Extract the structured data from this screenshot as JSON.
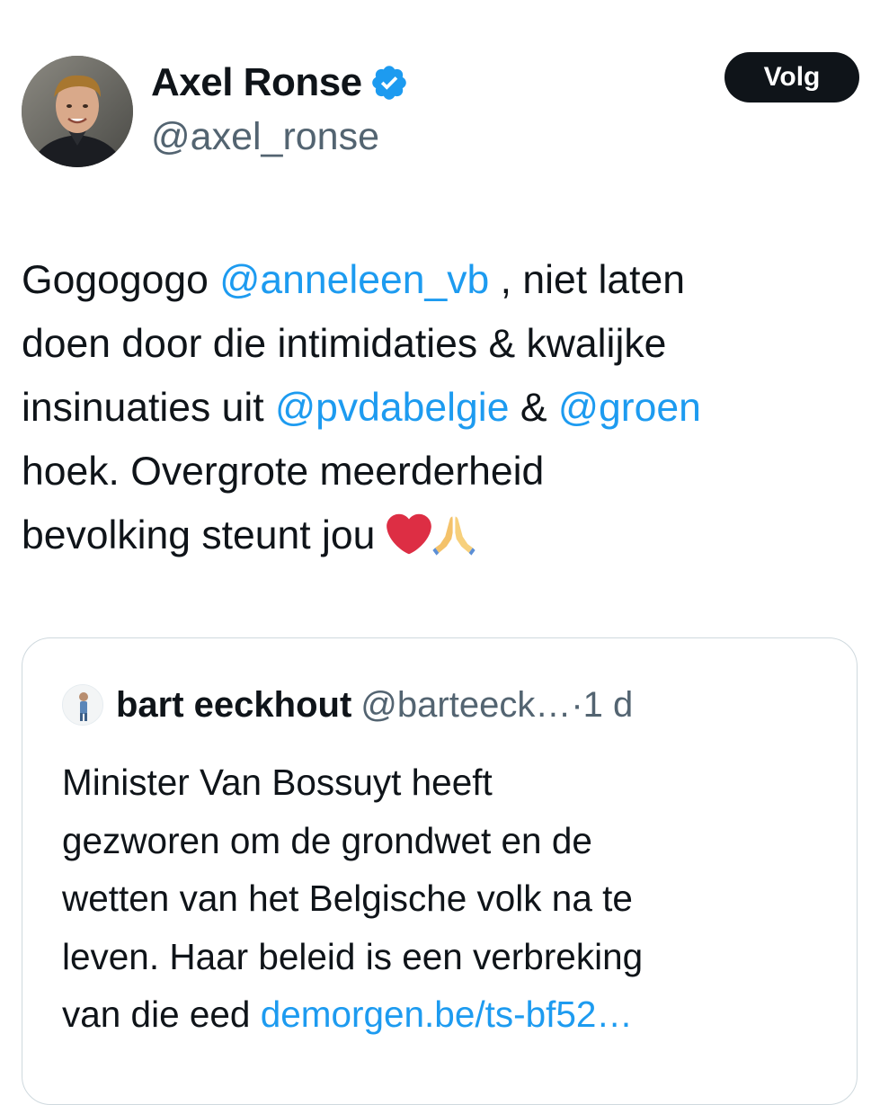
{
  "author": {
    "display_name": "Axel Ronse",
    "handle": "@axel_ronse",
    "verified_icon": "verified-badge-icon"
  },
  "follow_button": {
    "label": "Volg"
  },
  "tweet": {
    "lines": [
      [
        {
          "text": "Gogogogo "
        },
        {
          "text": "@anneleen_vb",
          "mention": true
        },
        {
          "text": " , niet laten"
        }
      ],
      [
        {
          "text": "doen door die intimidaties & kwalijke"
        }
      ],
      [
        {
          "text": "insinuaties uit "
        },
        {
          "text": "@pvdabelgie",
          "mention": true
        },
        {
          "text": " & "
        },
        {
          "text": "@groen",
          "mention": true
        }
      ],
      [
        {
          "text": "hoek. Overgrote meerderheid"
        }
      ],
      [
        {
          "text": "bevolking steunt jou "
        }
      ]
    ],
    "emojis": [
      "red-heart-icon",
      "folded-hands-icon"
    ]
  },
  "quote": {
    "author_name": "bart eeckhout",
    "author_handle": "@barteeck…",
    "separator": "·",
    "time": "1 d",
    "lines": [
      [
        {
          "text": "Minister Van Bossuyt heeft"
        }
      ],
      [
        {
          "text": "gezworen om de grondwet en de"
        }
      ],
      [
        {
          "text": "wetten van het Belgische volk na te"
        }
      ],
      [
        {
          "text": "leven. Haar beleid is een verbreking"
        }
      ],
      [
        {
          "text": "van die eed "
        },
        {
          "text": "demorgen.be/ts-bf52…",
          "link": true
        }
      ]
    ]
  },
  "colors": {
    "text": "#0f1419",
    "secondary": "#536471",
    "accent": "#1d9bf0",
    "border": "#cfd9de",
    "button_bg": "#0f1419"
  }
}
